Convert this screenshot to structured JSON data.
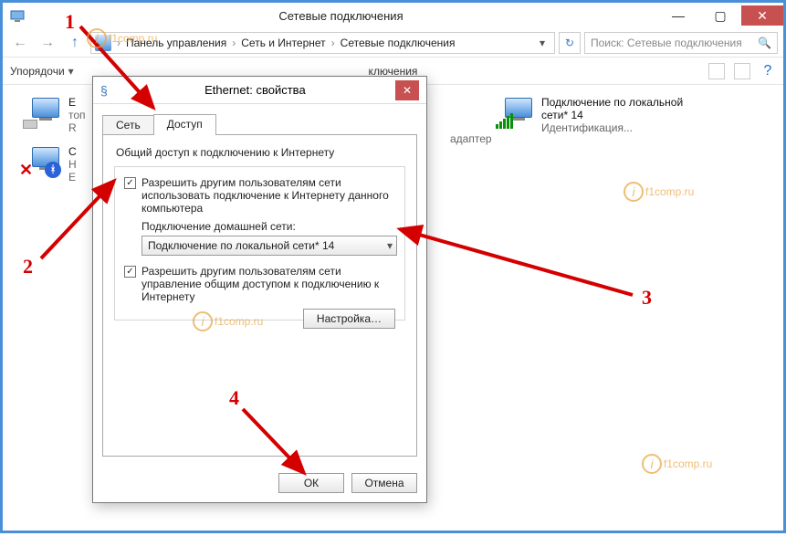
{
  "window": {
    "title": "Сетевые подключения",
    "min": "—",
    "max": "▢",
    "close": "✕"
  },
  "breadcrumbs": {
    "a": "Панель управления",
    "b": "Сеть и Интернет",
    "c": "Сетевые подключения",
    "sep": "›"
  },
  "search": {
    "placeholder": "Поиск: Сетевые подключения"
  },
  "toolbar": {
    "organize": "Упорядочи",
    "center": "ключения"
  },
  "grid": {
    "eth": {
      "line1": "E",
      "line2": "топ",
      "line3": "R"
    },
    "bt": {
      "line1": "С",
      "line2": "Н",
      "line3": "E"
    },
    "lan14": {
      "line1": "Подключение по локальной",
      "line2": "сети* 14",
      "line3": "Идентификация..."
    },
    "middle_label": "адаптер"
  },
  "dlg": {
    "title": "Ethernet: свойства",
    "tab_network": "Сеть",
    "tab_sharing": "Доступ",
    "group_title": "Общий доступ к подключению к Интернету",
    "chk1": "Разрешить другим пользователям сети использовать подключение к Интернету данного компьютера",
    "homenet_label": "Подключение домашней сети:",
    "homenet_value": "Подключение по локальной сети* 14",
    "chk2": "Разрешить другим пользователям сети управление общим доступом к подключению к Интернету",
    "settings_btn": "Настройка…",
    "ok": "ОК",
    "cancel": "Отмена"
  },
  "ann": {
    "n1": "1",
    "n2": "2",
    "n3": "3",
    "n4": "4",
    "wm": "f1comp.ru"
  },
  "glyph": {
    "back": "←",
    "fwd": "→",
    "up": "↑",
    "refresh": "↻",
    "search": "🔍",
    "dd": "▾",
    "check": "✓",
    "help": "?",
    "pin": "📌",
    "x": "✕"
  }
}
